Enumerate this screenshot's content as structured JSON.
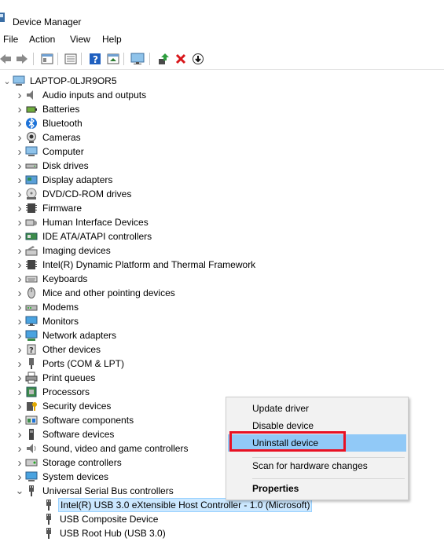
{
  "window": {
    "title": "Device Manager"
  },
  "menu": [
    "File",
    "Action",
    "View",
    "Help"
  ],
  "toolbar": [
    "back-icon",
    "forward-icon",
    "properties-icon",
    "list-icon",
    "help-icon",
    "action-icon",
    "monitor-icon",
    "update-driver-icon",
    "uninstall-icon",
    "download-icon"
  ],
  "tree": {
    "root": "LAPTOP-0LJR9OR5",
    "categories": [
      {
        "label": "Audio inputs and outputs",
        "icon": "speaker-icon"
      },
      {
        "label": "Batteries",
        "icon": "battery-icon"
      },
      {
        "label": "Bluetooth",
        "icon": "bluetooth-icon"
      },
      {
        "label": "Cameras",
        "icon": "camera-icon"
      },
      {
        "label": "Computer",
        "icon": "computer-icon"
      },
      {
        "label": "Disk drives",
        "icon": "disk-icon"
      },
      {
        "label": "Display adapters",
        "icon": "display-adapter-icon"
      },
      {
        "label": "DVD/CD-ROM drives",
        "icon": "dvd-icon"
      },
      {
        "label": "Firmware",
        "icon": "chip-icon"
      },
      {
        "label": "Human Interface Devices",
        "icon": "hid-icon"
      },
      {
        "label": "IDE ATA/ATAPI controllers",
        "icon": "ide-icon"
      },
      {
        "label": "Imaging devices",
        "icon": "imaging-icon"
      },
      {
        "label": "Intel(R) Dynamic Platform and Thermal Framework",
        "icon": "chip-icon"
      },
      {
        "label": "Keyboards",
        "icon": "keyboard-icon"
      },
      {
        "label": "Mice and other pointing devices",
        "icon": "mouse-icon"
      },
      {
        "label": "Modems",
        "icon": "modem-icon"
      },
      {
        "label": "Monitors",
        "icon": "monitor-icon"
      },
      {
        "label": "Network adapters",
        "icon": "network-icon"
      },
      {
        "label": "Other devices",
        "icon": "unknown-device-icon"
      },
      {
        "label": "Ports (COM & LPT)",
        "icon": "port-icon"
      },
      {
        "label": "Print queues",
        "icon": "printer-icon"
      },
      {
        "label": "Processors",
        "icon": "processor-icon"
      },
      {
        "label": "Security devices",
        "icon": "security-icon"
      },
      {
        "label": "Software components",
        "icon": "software-component-icon"
      },
      {
        "label": "Software devices",
        "icon": "software-device-icon"
      },
      {
        "label": "Sound, video and game controllers",
        "icon": "sound-icon"
      },
      {
        "label": "Storage controllers",
        "icon": "storage-icon"
      },
      {
        "label": "System devices",
        "icon": "system-icon"
      },
      {
        "label": "Universal Serial Bus controllers",
        "icon": "usb-icon"
      }
    ],
    "usb_children": [
      "Intel(R) USB 3.0 eXtensible Host Controller - 1.0 (Microsoft)",
      "USB Composite Device",
      "USB Root Hub (USB 3.0)"
    ]
  },
  "context_menu": {
    "update_driver": "Update driver",
    "disable_device": "Disable device",
    "uninstall_device": "Uninstall device",
    "scan": "Scan for hardware changes",
    "properties": "Properties"
  },
  "colors": {
    "highlight": "#91c9f7",
    "selection": "#cce8ff",
    "annotation": "#e81123"
  }
}
